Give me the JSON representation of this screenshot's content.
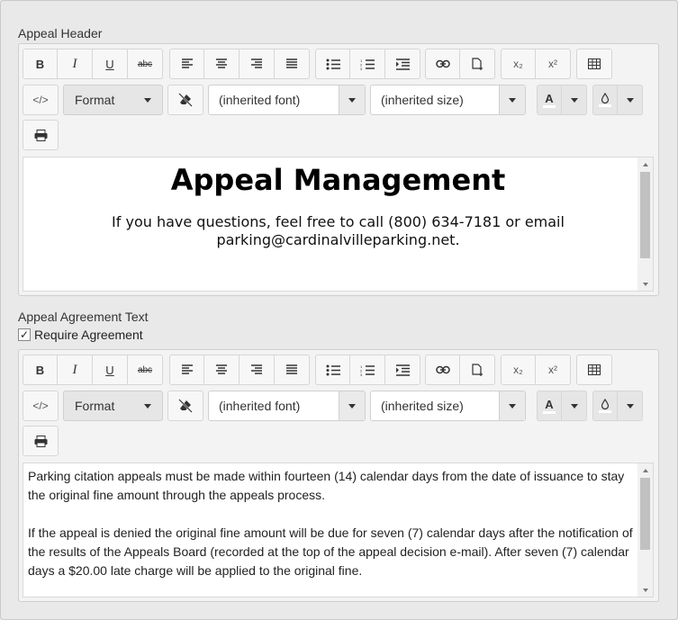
{
  "header_section": {
    "label": "Appeal Header",
    "title": "Appeal Management",
    "body": "If you have questions, feel free to call (800) 634-7181 or email parking@cardinalvilleparking.net."
  },
  "agreement_section": {
    "label": "Appeal Agreement Text",
    "checkbox_label": "Require Agreement",
    "checkbox_checked": true,
    "paragraphs": [
      "Parking citation appeals must be made within fourteen (14) calendar days from the date of issuance to stay the original fine amount through the appeals process.",
      "If the appeal is denied the original fine amount will be due for seven (7) calendar days after the notification of the results of the Appeals Board (recorded at the top of the appeal decision e-mail). After seven (7) calendar days a $20.00 late charge will be applied to the original fine."
    ]
  },
  "toolbar": {
    "bold": "B",
    "italic": "I",
    "underline": "U",
    "strikethrough": "abc",
    "format_label": "Format",
    "font_value": "(inherited font)",
    "size_value": "(inherited size)",
    "text_color_letter": "A",
    "code_label": "</>",
    "subscript": "x₂",
    "superscript": "x²",
    "icons": [
      "align-left-icon",
      "align-center-icon",
      "align-right-icon",
      "align-justify-icon",
      "bullet-list-icon",
      "numbered-list-icon",
      "indent-icon",
      "link-icon",
      "insert-file-icon",
      "table-icon",
      "code-view-icon",
      "clear-format-icon",
      "text-color-icon",
      "background-color-icon",
      "print-icon"
    ]
  },
  "colors": {
    "background": "#e9e9e9",
    "toolbar_button": "#f7f7f7",
    "border": "#cfcfcf",
    "scroll_thumb": "#c1c1c1"
  }
}
